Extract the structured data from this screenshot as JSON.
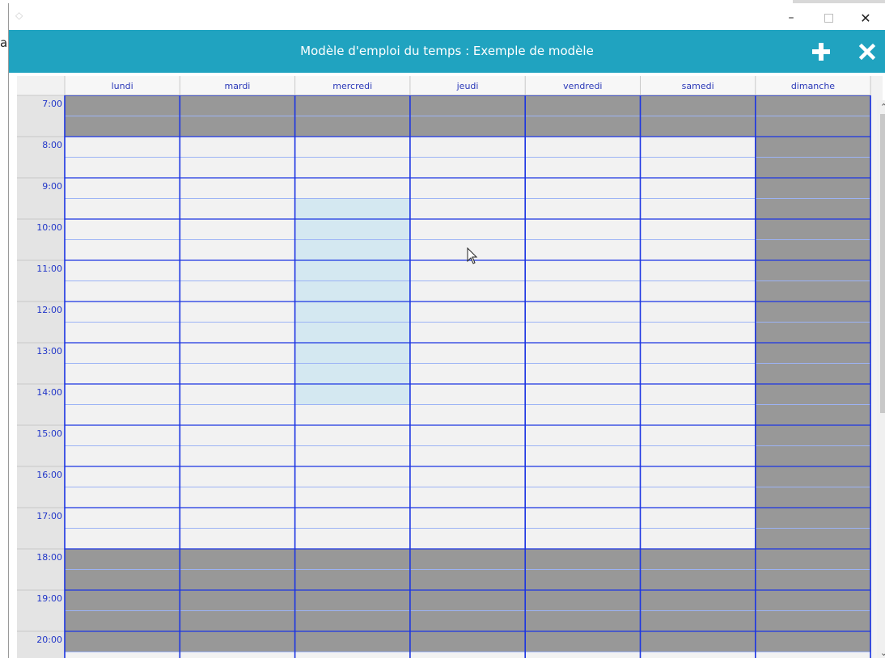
{
  "background": {
    "peek_char": "a"
  },
  "window": {
    "controls": {
      "minimize_glyph": "–",
      "close_glyph": "✕"
    }
  },
  "header": {
    "title": "Modèle d'emploi du temps : Exemple de modèle",
    "add_icon": "plus-icon",
    "close_icon": "close-icon",
    "background_color": "#20a3c0"
  },
  "schedule": {
    "days": [
      "lundi",
      "mardi",
      "mercredi",
      "jeudi",
      "vendredi",
      "samedi",
      "dimanche"
    ],
    "hours": [
      "7:00",
      "8:00",
      "9:00",
      "10:00",
      "11:00",
      "12:00",
      "13:00",
      "14:00",
      "15:00",
      "16:00",
      "17:00",
      "18:00",
      "19:00",
      "20:00"
    ],
    "blocked_periods": [
      {
        "days": [
          "lundi",
          "mardi",
          "mercredi",
          "jeudi",
          "vendredi",
          "samedi",
          "dimanche"
        ],
        "from": "7:00",
        "to": "8:00"
      },
      {
        "days": [
          "dimanche"
        ],
        "from": "8:00",
        "to": "18:00"
      },
      {
        "days": [
          "lundi",
          "mardi",
          "mercredi",
          "jeudi",
          "vendredi",
          "samedi",
          "dimanche"
        ],
        "from": "18:00",
        "to": "20:30"
      }
    ],
    "selection": {
      "day": "mercredi",
      "from": "9:30",
      "to": "14:30"
    },
    "colors": {
      "grid_line": "#1b34e3",
      "half_hour_line": "#9cb3f5",
      "open_slot": "#f2f2f2",
      "blocked_slot": "#989898",
      "selection": "#d4e8f1",
      "header_text": "#2a38b8",
      "time_text": "#2035c8",
      "time_column": "#e4e4e4"
    }
  }
}
